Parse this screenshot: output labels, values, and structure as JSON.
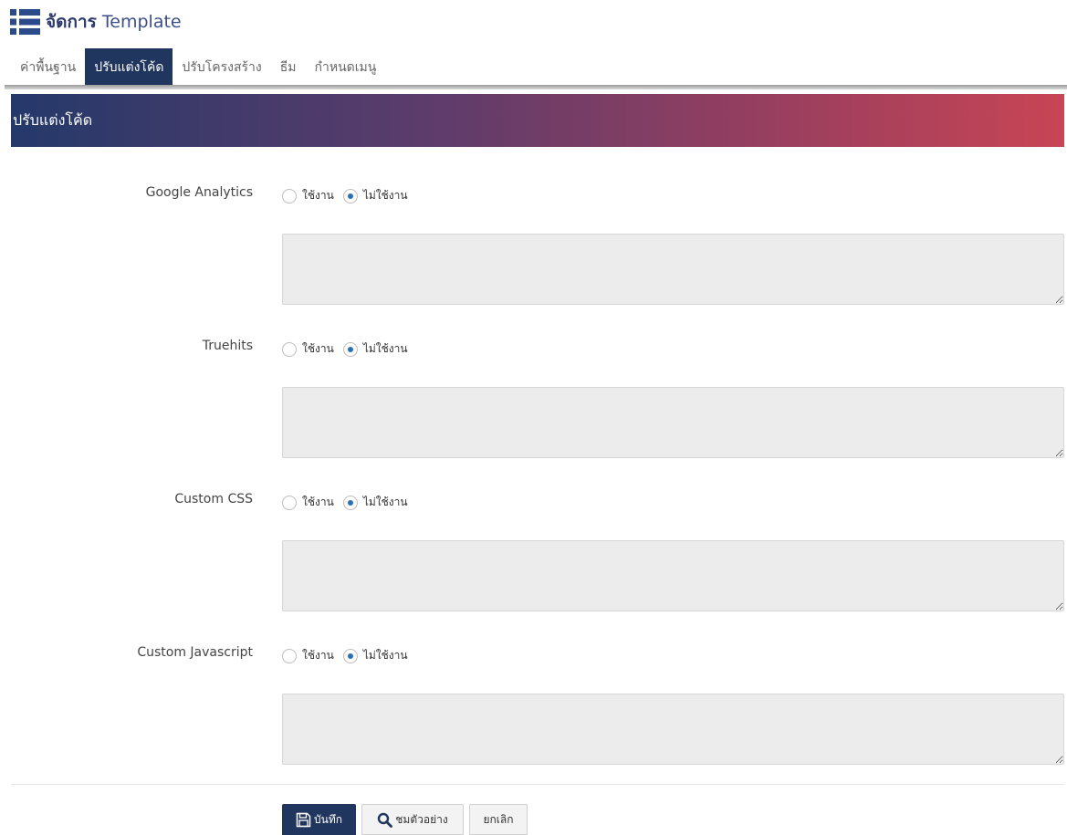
{
  "header": {
    "title_strong": "จัดการ",
    "title_light": "Template",
    "icon": "list-icon"
  },
  "tabs": [
    {
      "label": "ค่าพื้นฐาน",
      "active": false
    },
    {
      "label": "ปรับแต่งโค้ด",
      "active": true
    },
    {
      "label": "ปรับโครงสร้าง",
      "active": false
    },
    {
      "label": "ธีม",
      "active": false
    },
    {
      "label": "กำหนดเมนู",
      "active": false
    }
  ],
  "section": {
    "title": "ปรับแต่งโค้ด"
  },
  "radio_labels": {
    "enable": "ใช้งาน",
    "disable": "ไม่ใช้งาน"
  },
  "fields": [
    {
      "label": "Google Analytics",
      "selected": "disable",
      "value": ""
    },
    {
      "label": "Truehits",
      "selected": "disable",
      "value": ""
    },
    {
      "label": "Custom CSS",
      "selected": "disable",
      "value": ""
    },
    {
      "label": "Custom Javascript",
      "selected": "disable",
      "value": ""
    }
  ],
  "buttons": {
    "save": "บันทึก",
    "preview": "ชมตัวอย่าง",
    "cancel": "ยกเลิก"
  },
  "colors": {
    "brand": "#20365e",
    "gradient_start": "#24396a",
    "gradient_end": "#c84554",
    "radio_selected": "#2a6fba"
  }
}
